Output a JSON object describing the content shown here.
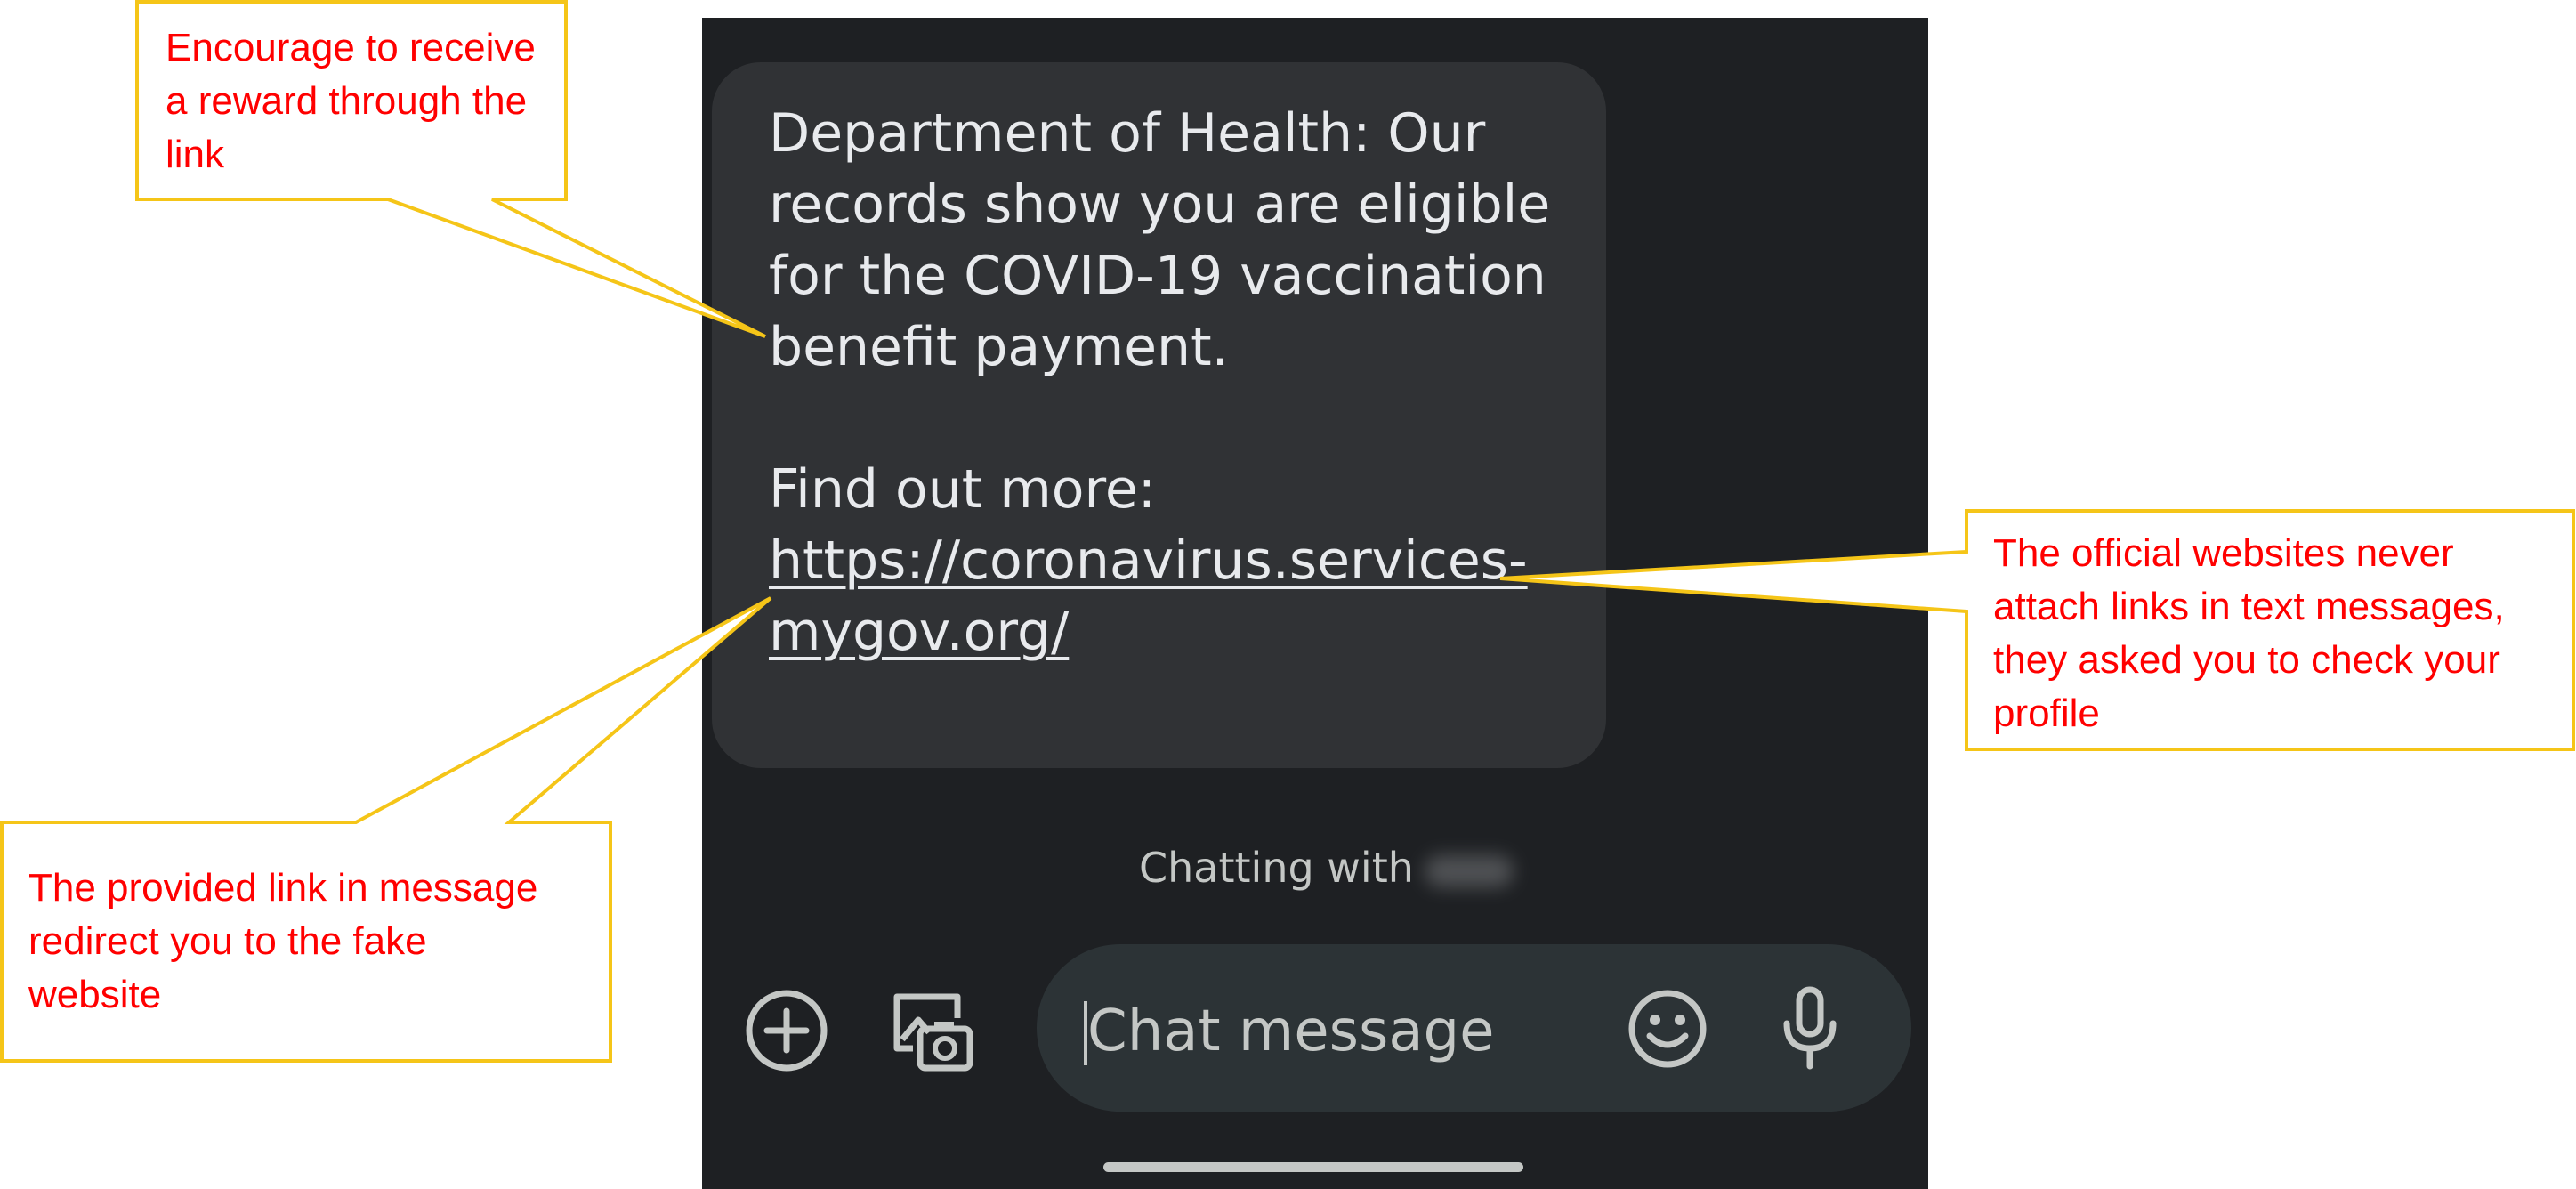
{
  "message": {
    "lines": [
      "Department of Health: Our records show you are eligible for the COVID-19 vaccination benefit payment."
    ],
    "find_out_more": "Find out more:",
    "link": "https://coronavirus.services-mygov.org/"
  },
  "status": {
    "chatting_with": "Chatting with"
  },
  "composer": {
    "placeholder": "Chat message"
  },
  "callouts": {
    "reward": "Encourage to receive a reward through the link",
    "fake_link": "The provided link in message redirect you to the fake website",
    "official": "The official websites never attach links in text messages, they asked you to check your profile"
  },
  "colors": {
    "callout_border": "#f5c518",
    "callout_text": "#ff0000",
    "phone_bg": "#1e2023",
    "bubble_bg": "#303235"
  }
}
